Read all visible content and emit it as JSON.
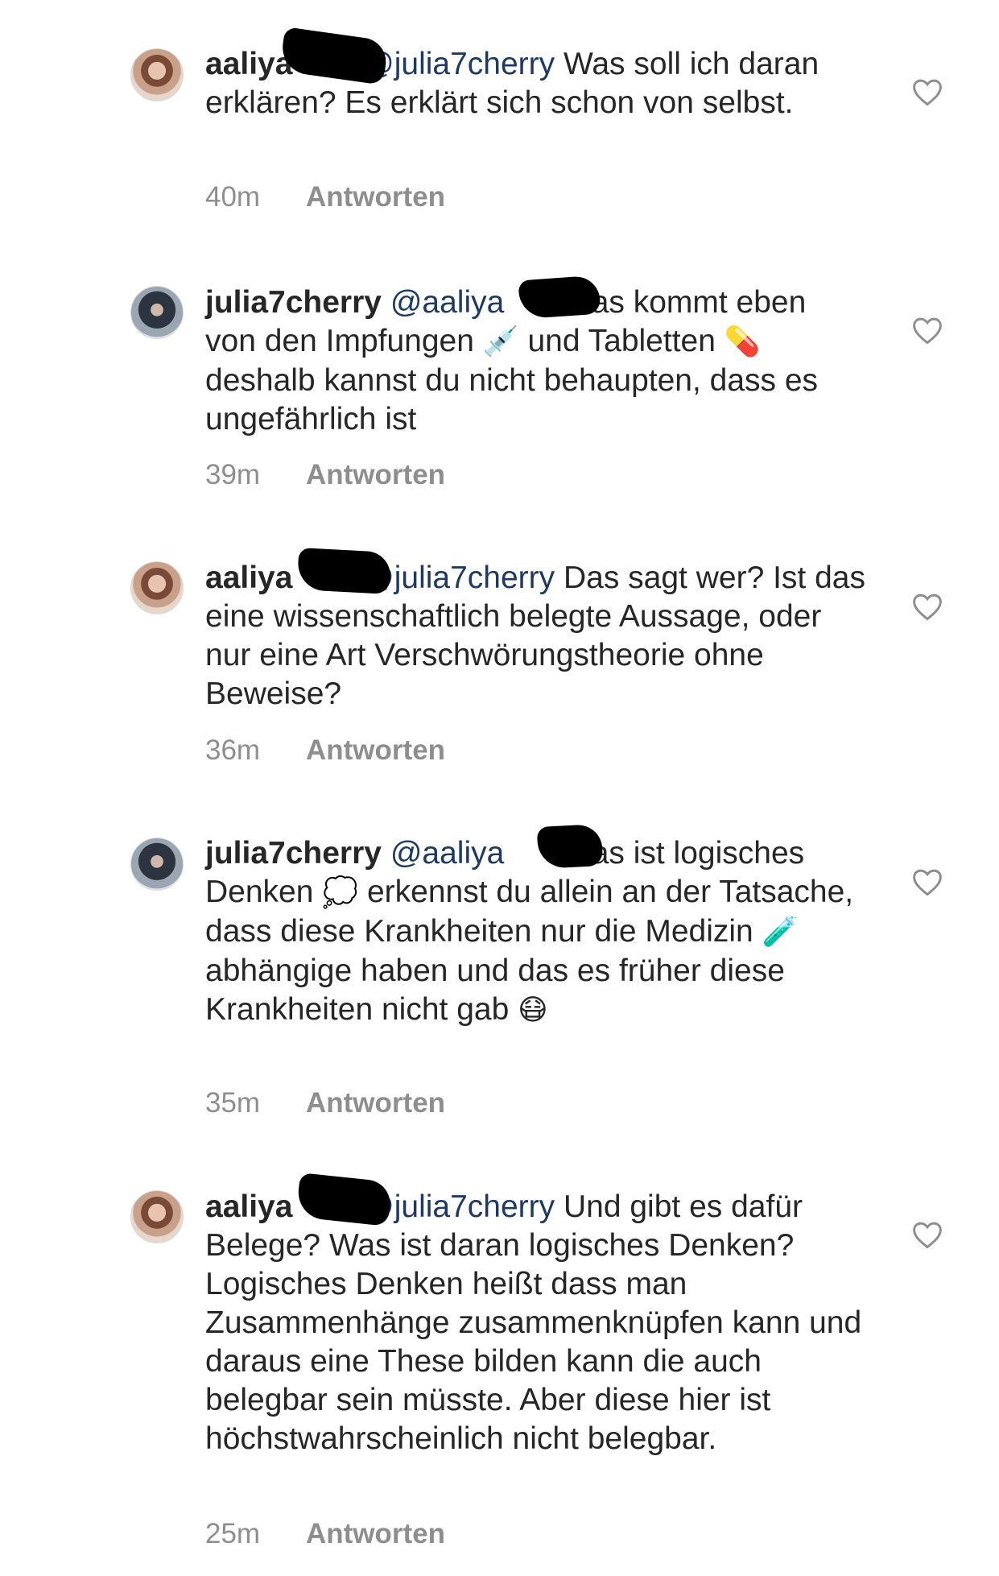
{
  "comments": [
    {
      "username": "aaliya",
      "mention": "@julia7cherry",
      "body": "Was soll ich daran erklären? Es erklärt sich schon von selbst.",
      "time": "40m",
      "reply": "Antworten"
    },
    {
      "username": "julia7cherry",
      "mention": "@aaliya",
      "body_1": "das kommt eben von den Impfungen",
      "emoji_1": "💉",
      "body_2": "und Tabletten",
      "emoji_2": "💊",
      "body_3": "deshalb kannst du nicht behaupten, dass es ungefährlich ist",
      "time": "39m",
      "reply": "Antworten"
    },
    {
      "username": "aaliya",
      "mention": "@julia7cherry",
      "body": "Das sagt wer? Ist das eine wissenschaftlich belegte Aussage, oder nur eine Art Verschwörungstheorie ohne Beweise?",
      "time": "36m",
      "reply": "Antworten"
    },
    {
      "username": "julia7cherry",
      "mention": "@aaliya",
      "body_1": "das ist logisches Denken",
      "emoji_1": "💭",
      "body_2": "erkennst du allein an der Tatsache, dass diese Krankheiten nur die Medizin",
      "emoji_2": "🧪",
      "body_3": "abhängige haben und das es früher diese Krankheiten nicht gab",
      "emoji_3": "😷",
      "time": "35m",
      "reply": "Antworten"
    },
    {
      "username": "aaliya",
      "mention": "@julia7cherry",
      "body": "Und gibt es dafür Belege? Was ist daran logisches Denken? Logisches Denken heißt dass man Zusammenhänge zusammenknüpfen kann und daraus eine These bilden kann die auch belegbar sein müsste. Aber diese hier ist höchstwahrscheinlich nicht belegbar.",
      "time": "25m",
      "reply": "Antworten"
    }
  ]
}
